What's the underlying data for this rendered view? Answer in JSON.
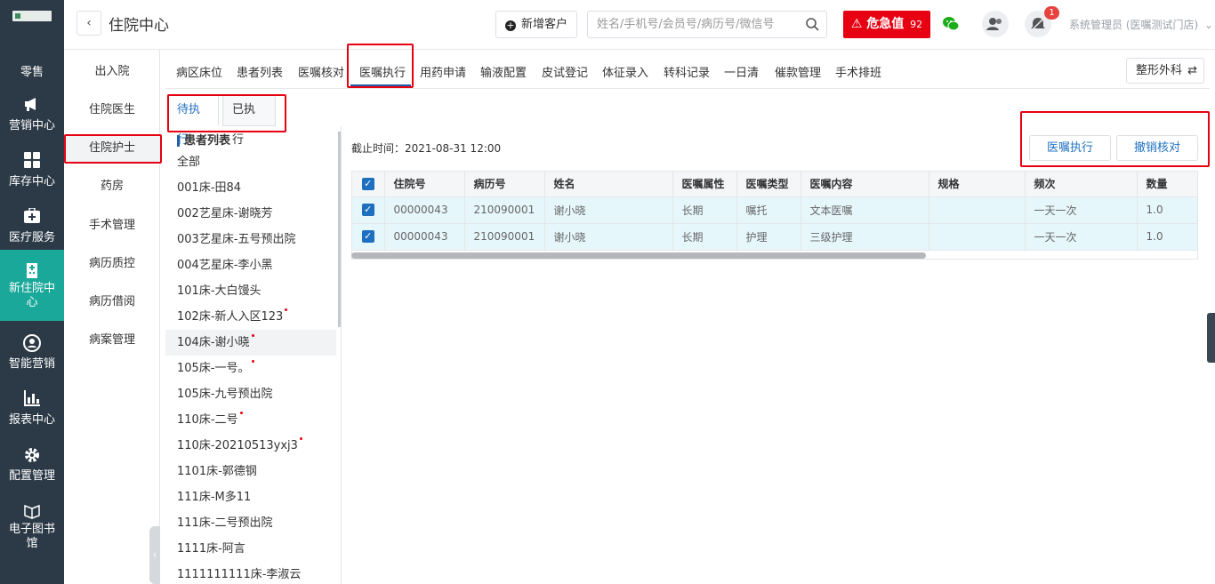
{
  "sidebar": {
    "items": [
      {
        "label": "零售"
      },
      {
        "label": "营销中心"
      },
      {
        "label": "库存中心"
      },
      {
        "label": "医疗服务"
      },
      {
        "label": "新住院中心"
      },
      {
        "label": "智能营销"
      },
      {
        "label": "报表中心"
      },
      {
        "label": "配置管理"
      },
      {
        "label": "电子图书馆"
      }
    ]
  },
  "subnav": {
    "items": [
      "出入院",
      "住院医生",
      "住院护士",
      "药房",
      "手术管理",
      "病历质控",
      "病历借阅",
      "病案管理"
    ]
  },
  "header": {
    "title": "住院中心",
    "add_customer": "新增客户",
    "search_placeholder": "姓名/手机号/会员号/病历号/微信号",
    "danger_label": "危急值",
    "danger_count": "92",
    "notification_count": "1",
    "user": "系统管理员 (医嘱测试门店)"
  },
  "tabs": [
    "病区床位",
    "患者列表",
    "医嘱核对",
    "医嘱执行",
    "用药申请",
    "输液配置",
    "皮试登记",
    "体征录入",
    "转科记录",
    "一日清",
    "催款管理",
    "手术排班"
  ],
  "department": "整形外科",
  "subtabs": [
    "待执行",
    "已执行"
  ],
  "patients": {
    "title": "患者列表",
    "items": [
      {
        "label": "全部",
        "dot": false
      },
      {
        "label": "001床-田84",
        "dot": false
      },
      {
        "label": "002艺星床-谢晓芳",
        "dot": false
      },
      {
        "label": "003艺星床-五号预出院",
        "dot": false
      },
      {
        "label": "004艺星床-李小黑",
        "dot": false
      },
      {
        "label": "101床-大白馒头",
        "dot": false
      },
      {
        "label": "102床-新人入区123",
        "dot": true
      },
      {
        "label": "104床-谢小晓",
        "dot": true
      },
      {
        "label": "105床-一号。",
        "dot": true
      },
      {
        "label": "105床-九号预出院",
        "dot": false
      },
      {
        "label": "110床-二号",
        "dot": true
      },
      {
        "label": "110床-20210513yxj3",
        "dot": true
      },
      {
        "label": "1101床-郭德钢",
        "dot": false
      },
      {
        "label": "111床-M多11",
        "dot": false
      },
      {
        "label": "111床-二号预出院",
        "dot": false
      },
      {
        "label": "1111床-阿言",
        "dot": false
      },
      {
        "label": "1111111111床-李淑云",
        "dot": false
      }
    ]
  },
  "main": {
    "deadline": "截止时间：2021-08-31 12:00",
    "execute_button": "医嘱执行",
    "cancel_button": "撤销核对",
    "columns": [
      "住院号",
      "病历号",
      "姓名",
      "医嘱属性",
      "医嘱类型",
      "医嘱内容",
      "规格",
      "频次",
      "数量"
    ],
    "rows": [
      [
        "00000043",
        "210090001",
        "谢小晓",
        "长期",
        "嘱托",
        "文本医嘱",
        "",
        "一天一次",
        "1.0"
      ],
      [
        "00000043",
        "210090001",
        "谢小晓",
        "长期",
        "护理",
        "三级护理",
        "",
        "一天一次",
        "1.0"
      ]
    ]
  },
  "colors": {
    "sidebar_bg": "#2c3a47",
    "accent_teal": "#1aa89a",
    "danger": "#e60012",
    "primary_blue": "#1f6fc0",
    "row_highlight": "#e6f7fb"
  }
}
